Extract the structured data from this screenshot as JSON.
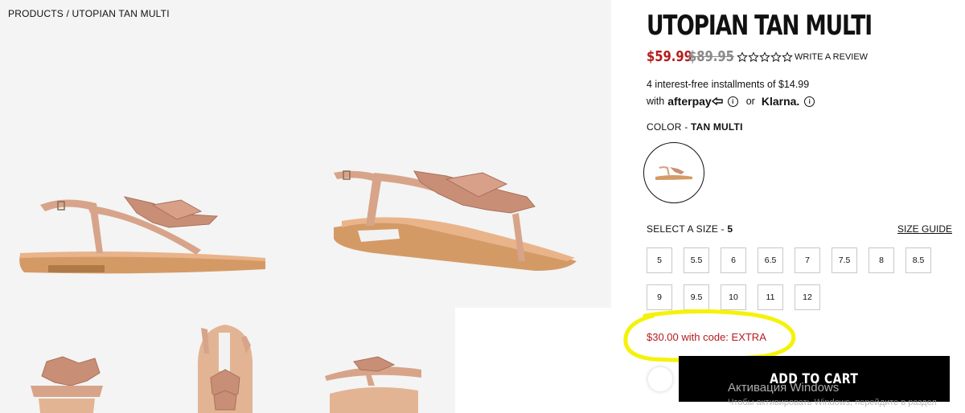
{
  "breadcrumb": "PRODUCTS / UTOPIAN TAN MULTI",
  "product": {
    "title": "UTOPIAN TAN MULTI",
    "sale_price": "$59.99",
    "original_price": "$89.95",
    "rating_stars": 0,
    "review_link": "WRITE A REVIEW"
  },
  "installments": {
    "line1": "4 interest-free installments of $14.99",
    "with_text": "with",
    "afterpay": "afterpay",
    "or_text": "or",
    "klarna": "Klarna.",
    "info_glyph": "i"
  },
  "color": {
    "label": "COLOR - ",
    "value": "TAN MULTI"
  },
  "size": {
    "label": "SELECT A SIZE - ",
    "selected": "5",
    "guide_label": "SIZE GUIDE",
    "options": [
      "5",
      "5.5",
      "6",
      "6.5",
      "7",
      "7.5",
      "8",
      "8.5",
      "9",
      "9.5",
      "10",
      "11",
      "12"
    ]
  },
  "promo": "$30.00 with code: EXTRA",
  "add_to_cart": "ADD TO CART",
  "watermark": {
    "line1": "Активация Windows",
    "line2": "Чтобы активировать Windows, перейдите в раздел"
  },
  "colors": {
    "sale": "#b51c1c",
    "highlight": "#f5f20a",
    "sandal_strap": "#d7a48a",
    "sole": "#d49a66"
  }
}
